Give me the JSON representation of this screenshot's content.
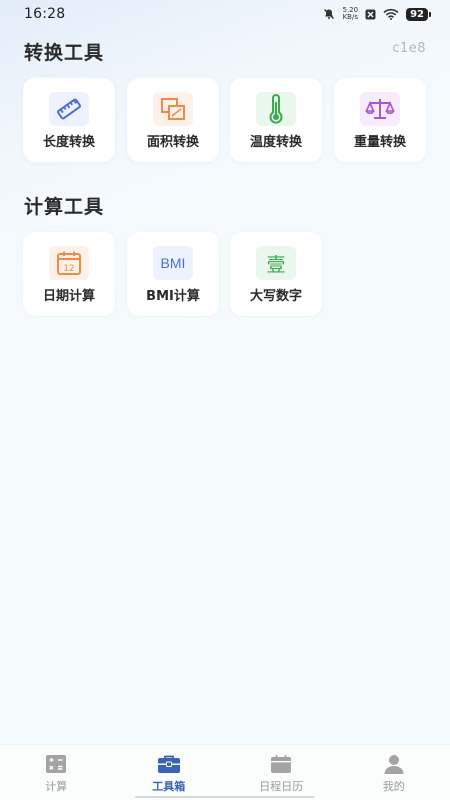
{
  "status_bar": {
    "time": "16:28",
    "net_speed_value": "5.20",
    "net_speed_unit": "KB/s",
    "battery": "92"
  },
  "version": "c1e8",
  "sections": {
    "convert_title": "转换工具",
    "calc_title": "计算工具"
  },
  "convert_tools": [
    {
      "label": "长度转换",
      "icon": "ruler-icon",
      "color": "#4a6fd0"
    },
    {
      "label": "面积转换",
      "icon": "area-icon",
      "color": "#f08a4b"
    },
    {
      "label": "温度转换",
      "icon": "thermometer-icon",
      "color": "#3aaa50"
    },
    {
      "label": "重量转换",
      "icon": "scale-icon",
      "color": "#a855d6"
    }
  ],
  "calc_tools": [
    {
      "label": "日期计算",
      "icon": "calendar-icon",
      "icon_text": "12",
      "color": "#f08a4b"
    },
    {
      "label": "BMI计算",
      "icon": "bmi-icon",
      "icon_text": "BMI",
      "color": "#4a6fd0"
    },
    {
      "label": "大写数字",
      "icon": "chinese-numeral-icon",
      "icon_text": "壹",
      "color": "#3aaa50"
    }
  ],
  "tabs": [
    {
      "label": "计算",
      "icon": "calculator-icon",
      "active": false
    },
    {
      "label": "工具箱",
      "icon": "toolbox-icon",
      "active": true
    },
    {
      "label": "日程日历",
      "icon": "calendar-icon",
      "active": false
    },
    {
      "label": "我的",
      "icon": "user-icon",
      "active": false
    }
  ],
  "colors": {
    "accent": "#3a63b8",
    "inactive": "#9a9a9a"
  }
}
